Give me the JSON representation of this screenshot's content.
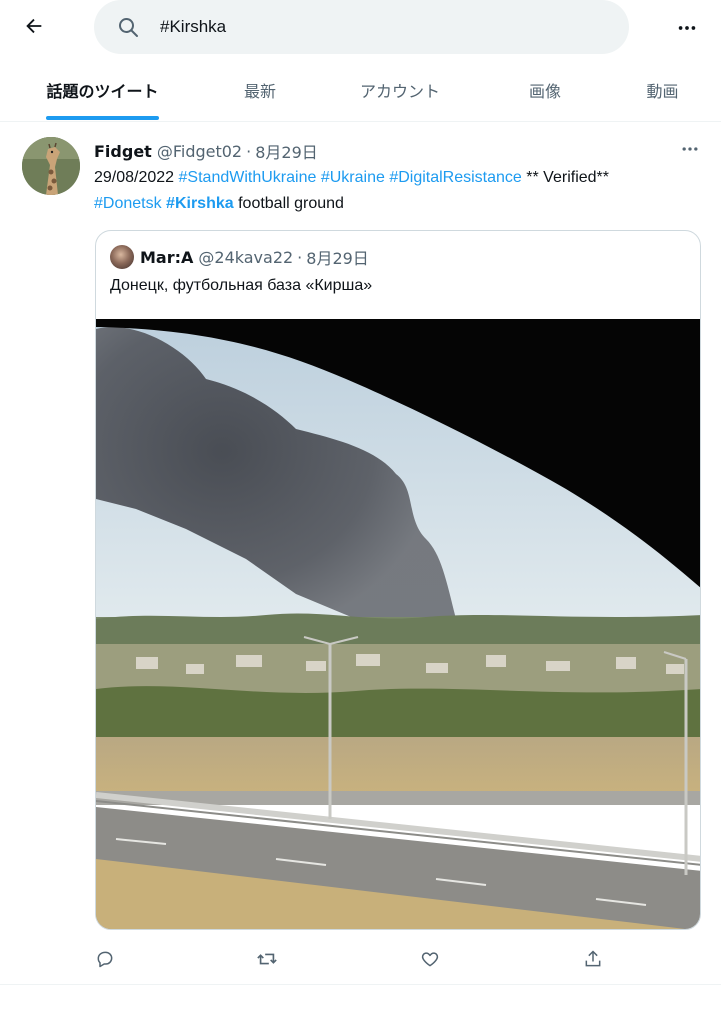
{
  "search": {
    "value": "#Kirshka",
    "placeholder": ""
  },
  "tabs": [
    {
      "label": "話題のツイート",
      "active": true
    },
    {
      "label": "最新",
      "active": false
    },
    {
      "label": "アカウント",
      "active": false
    },
    {
      "label": "画像",
      "active": false
    },
    {
      "label": "動画",
      "active": false
    }
  ],
  "tweet": {
    "author_name": "Fidget",
    "author_handle": "@Fidget02",
    "separator": "·",
    "date": "8月29日",
    "body": {
      "date_text": "29/08/2022",
      "hashtag_1": "#StandWithUkraine",
      "hashtag_2": "#Ukraine",
      "hashtag_3": "#DigitalResistance",
      "verified_text": "** Verified**",
      "hashtag_4": "#Donetsk",
      "hashtag_5": "#Kirshka",
      "tail_text": "football ground"
    },
    "quote": {
      "author_name": "Mar:A",
      "author_handle": "@24kava22",
      "separator": "·",
      "date": "8月29日",
      "text": "Донецк, футбольная база «Кирша»"
    }
  },
  "icons": {
    "back": "arrow-left-icon",
    "search": "search-icon",
    "more": "more-horizontal-icon",
    "reply": "reply-icon",
    "retweet": "retweet-icon",
    "like": "heart-icon",
    "share": "share-icon"
  },
  "colors": {
    "accent": "#1d9bf0",
    "text_primary": "#0f1419",
    "text_secondary": "#536471",
    "search_bg": "#eff3f4",
    "border": "#cfd9de"
  }
}
